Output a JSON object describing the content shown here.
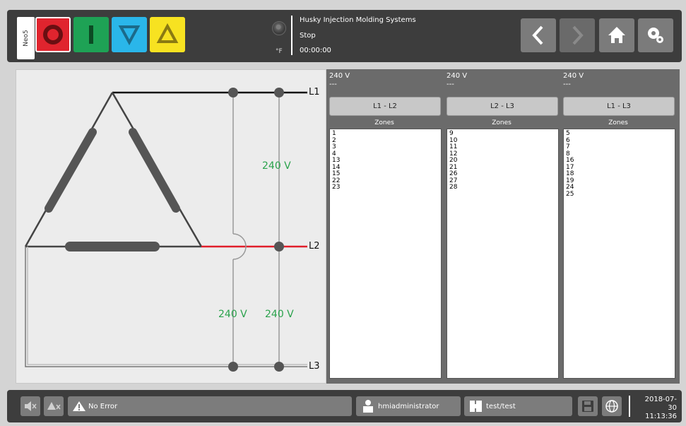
{
  "header": {
    "tab_label": "Neo5",
    "temp_unit": "°F",
    "company": "Husky Injection Molding Systems",
    "machine_state": "Stop",
    "timer": "00:00:00"
  },
  "controls": {
    "stop": "stop",
    "run": "run",
    "down": "down",
    "up": "up"
  },
  "nav": {
    "back_icon": "chevron-left-icon",
    "forward_icon": "chevron-right-icon",
    "home_icon": "home-icon",
    "settings_icon": "gear-icon"
  },
  "diagram": {
    "line_labels": [
      "L1",
      "L2",
      "L3"
    ],
    "voltage_l1_l2": "240 V",
    "voltage_l1_l3": "240 V",
    "voltage_l2_l3": "240 V"
  },
  "phases": [
    {
      "voltage": "240 V",
      "sub": "---",
      "button": "L1 - L2",
      "zones_label": "Zones",
      "zones": [
        "1",
        "2",
        "3",
        "4",
        "13",
        "14",
        "15",
        "22",
        "23"
      ]
    },
    {
      "voltage": "240 V",
      "sub": "---",
      "button": "L2 - L3",
      "zones_label": "Zones",
      "zones": [
        "9",
        "10",
        "11",
        "12",
        "20",
        "21",
        "26",
        "27",
        "28"
      ]
    },
    {
      "voltage": "240 V",
      "sub": "---",
      "button": "L1 - L3",
      "zones_label": "Zones",
      "zones": [
        "5",
        "6",
        "7",
        "8",
        "16",
        "17",
        "18",
        "19",
        "24",
        "25"
      ]
    }
  ],
  "footer": {
    "alarm_status": "No Error",
    "user": "hmiadministrator",
    "mold": "test/test",
    "date": "2018-07-30",
    "time": "11:13:36"
  },
  "colors": {
    "stop": "#e0242e",
    "run": "#1ea255",
    "down": "#2ab6ea",
    "up": "#f7e221",
    "voltage_text": "#2aa24c",
    "l2_wire": "#e01e2a"
  }
}
